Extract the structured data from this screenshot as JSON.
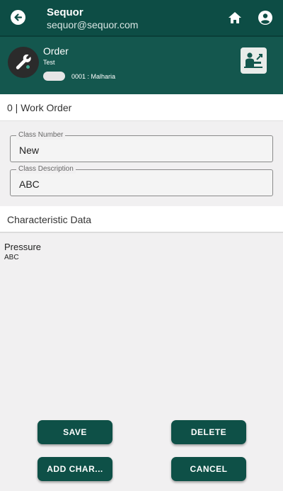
{
  "topbar": {
    "title": "Sequor",
    "subtitle": "sequor@sequor.com",
    "icons": [
      "back-arrow-icon",
      "home-icon",
      "account-circle-icon"
    ],
    "background": "#0d4d45"
  },
  "order": {
    "title": "Order",
    "subtitle": "Test",
    "code": "0001 : Malharia",
    "icons": [
      "wrench-icon",
      "operator-icon"
    ],
    "background": "#14574e"
  },
  "work_order": {
    "label": "0 | Work Order"
  },
  "form": {
    "class_number": {
      "label": "Class Number",
      "value": "New"
    },
    "class_description": {
      "label": "Class Description",
      "value": "ABC"
    }
  },
  "characteristic": {
    "header": "Characteristic Data",
    "items": [
      {
        "name": "Pressure",
        "value": "ABC"
      }
    ]
  },
  "buttons": {
    "save": "SAVE",
    "delete": "DELETE",
    "add_char": "ADD CHAR...",
    "cancel": "CANCEL",
    "color": "#0e5047"
  }
}
